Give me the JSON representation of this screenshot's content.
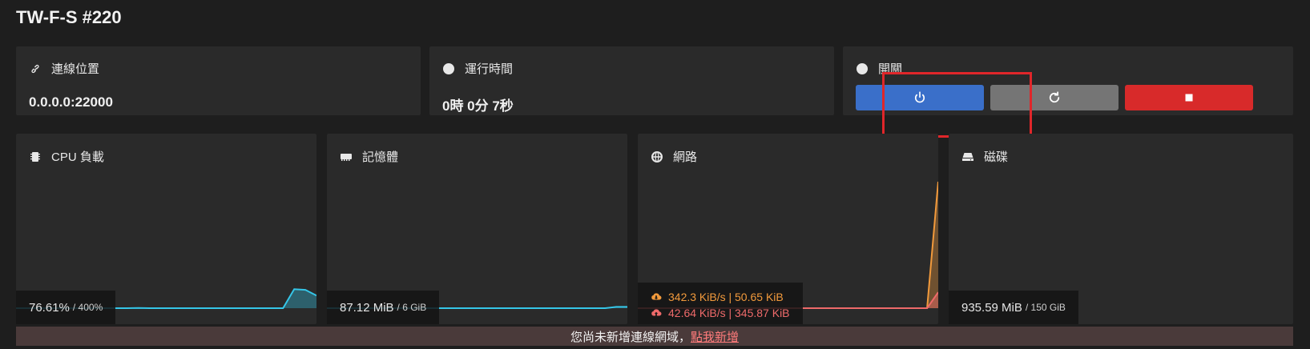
{
  "server": {
    "title": "TW-F-S #220"
  },
  "info_cards": {
    "address": {
      "label": "連線位置",
      "value": "0.0.0.0:22000",
      "icon": "link-icon"
    },
    "uptime": {
      "label": "運行時間",
      "value": "0時 0分 7秒",
      "icon": "clock-icon"
    },
    "power": {
      "label": "開關",
      "icon": "clock-icon"
    }
  },
  "power_buttons": {
    "start": {
      "icon": "power-icon",
      "color": "#3a6fc9"
    },
    "restart": {
      "icon": "refresh-icon",
      "color": "#757575"
    },
    "stop": {
      "icon": "stop-icon",
      "color": "#d82a2a"
    }
  },
  "stats": {
    "cpu": {
      "label": "CPU 負載",
      "value": "76.61%",
      "limit": "/ 400%",
      "icon": "cpu-icon",
      "color": "#35c6e8"
    },
    "memory": {
      "label": "記憶體",
      "value": "87.12 MiB",
      "limit": "/ 6 GiB",
      "icon": "memory-icon",
      "color": "#35c6e8"
    },
    "network": {
      "label": "網路",
      "icon": "globe-icon",
      "down_value": "342.3 KiB/s | 50.65 KiB",
      "down_color": "#f29a3c",
      "up_value": "42.64 KiB/s | 345.87 KiB",
      "up_color": "#ee6a6a"
    },
    "disk": {
      "label": "磁碟",
      "value": "935.59 MiB",
      "limit": "/ 150 GiB",
      "icon": "disk-icon"
    }
  },
  "chart_data": [
    {
      "type": "area",
      "title": "CPU 負載",
      "series": [
        {
          "values": [
            0,
            0,
            0,
            0,
            0,
            0,
            0,
            0,
            0,
            0,
            0,
            0.5,
            0,
            0,
            0,
            0,
            0,
            0,
            0,
            0,
            0,
            0,
            0,
            0,
            0,
            60,
            58,
            40
          ]
        }
      ],
      "ylim": [
        0,
        400
      ]
    },
    {
      "type": "area",
      "title": "記憶體",
      "series": [
        {
          "values": [
            0,
            0,
            0,
            0,
            0,
            0,
            0,
            0,
            0,
            0,
            0,
            0,
            0,
            0,
            0,
            0,
            0,
            0,
            0,
            0,
            0,
            0,
            0,
            0,
            0,
            0,
            1,
            1
          ]
        }
      ],
      "ylim": [
        0,
        100
      ]
    },
    {
      "type": "area",
      "title": "網路",
      "series": [
        {
          "values": [
            0,
            0,
            0,
            0,
            0,
            0,
            0,
            0,
            0,
            0,
            0,
            0,
            0,
            0,
            0,
            0,
            0,
            0,
            0,
            0,
            0,
            0,
            0,
            0,
            0,
            0,
            0,
            342
          ]
        },
        {
          "values": [
            0,
            0,
            0,
            0,
            0,
            0,
            0,
            0,
            0,
            0,
            0,
            0,
            0,
            0,
            0,
            0,
            0,
            0,
            0,
            0,
            0,
            0,
            0,
            0,
            0,
            0,
            0,
            43
          ]
        }
      ],
      "ylim": [
        0,
        342
      ]
    }
  ],
  "banner": {
    "text": "您尚未新增連線網域，",
    "link": "點我新增"
  }
}
